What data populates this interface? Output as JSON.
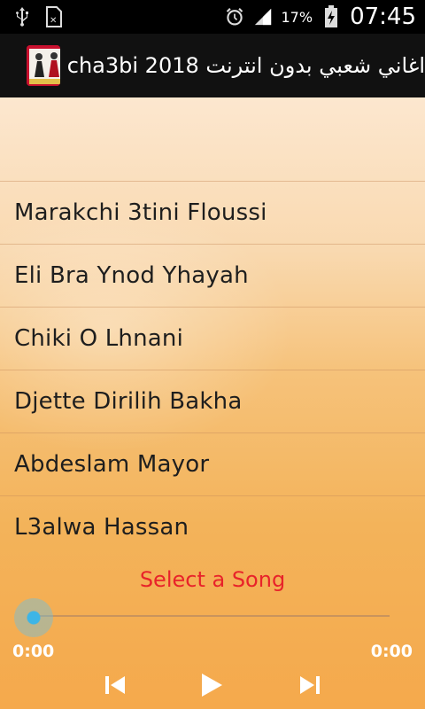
{
  "status_bar": {
    "battery_percent": "17%",
    "time": "07:45",
    "icons": [
      "usb-icon",
      "sim-icon",
      "alarm-icon",
      "signal-icon",
      "battery-charging-icon"
    ]
  },
  "app": {
    "title": "cha3bi 2018 اغاني شعبي بدون انترنت",
    "icon": "app-logo-icon"
  },
  "songs": [
    "Marakchi 3tini Floussi",
    "Eli Bra Ynod Yhayah",
    "Chiki O Lhnani",
    "Djette Dirilih Bakha",
    "Abdeslam Mayor",
    "L3alwa Hassan"
  ],
  "player": {
    "status": "Select a Song",
    "elapsed": "0:00",
    "duration": "0:00",
    "progress_fraction": 0,
    "controls": [
      "previous-icon",
      "play-icon",
      "next-icon"
    ]
  },
  "colors": {
    "status_text": "#e8232a",
    "seek_thumb": "#3db5e6",
    "actionbar_bg": "#111111"
  }
}
